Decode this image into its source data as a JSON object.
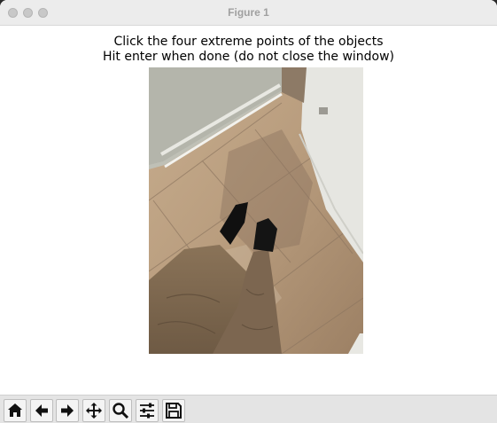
{
  "window": {
    "title": "Figure 1"
  },
  "figure": {
    "title_line1": "Click the four extreme points of the objects",
    "title_line2": "Hit enter when done (do not close the window)"
  },
  "toolbar": {
    "buttons": [
      {
        "name": "home",
        "icon": "home-icon"
      },
      {
        "name": "back",
        "icon": "arrow-left-icon"
      },
      {
        "name": "forward",
        "icon": "arrow-right-icon"
      },
      {
        "name": "pan",
        "icon": "move-icon"
      },
      {
        "name": "zoom",
        "icon": "magnifier-icon"
      },
      {
        "name": "configure-subplots",
        "icon": "sliders-icon"
      },
      {
        "name": "save",
        "icon": "floppy-disk-icon"
      }
    ]
  }
}
